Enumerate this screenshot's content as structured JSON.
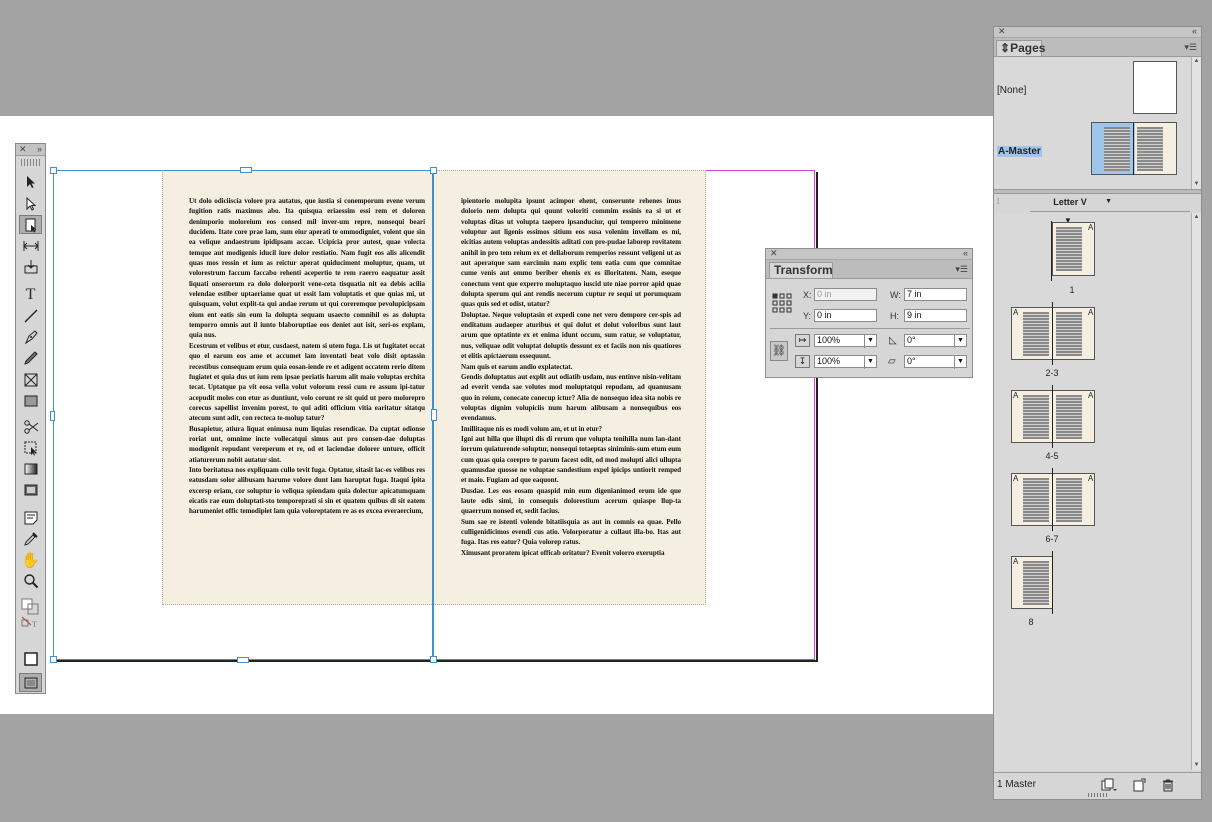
{
  "transform_panel": {
    "title": "Transform",
    "x_label": "X:",
    "x_value": "0 in",
    "y_label": "Y:",
    "y_value": "0 in",
    "w_label": "W:",
    "w_value": "7 in",
    "h_label": "H:",
    "h_value": "9 in",
    "scale_x": "100%",
    "scale_y": "100%",
    "rotate": "0°",
    "shear": "0°"
  },
  "pages_panel": {
    "title": "Pages",
    "none_label": "[None]",
    "master_label": "A-Master",
    "size_select": "Letter V",
    "footer_text": "1 Master",
    "page_labels": [
      "1",
      "2-3",
      "4-5",
      "6-7",
      "8"
    ],
    "master_prefix": "A"
  },
  "document": {
    "left_column": "Ut dolo odiciiscia volore pra autatus, que iustia si conemporum evene verum fugition ratis maximus abo. Ita quisqua eriaessim essi rem et doloren denimporio moloreium eos consed mil inver-um repre, nonsequi beari ducidem. Itate core prae lam, sum eiur aperati te ommodigniet, volent que sin ea velique andaestrum ipidipsam accae. Ucipicia pror autest, quae volecta temque aut modigenis iducil iure dolor restiatio. Nam fugit eos alis alicendit quas mos ressin et ium as reictur aperat quiduciment moluptur, quam, ut volorestrum faccum faccabo rehenti acepertio te rem raerro eaquatur assit liquati onserorum ra dolo dolorporit vene-ceta tisquatia nit ea debis acilia velendae estiber uptaeriame quat ut essit lam voluptatis et que quias mi, ut quisquam, volut explit-ta qui andae rerum ut qui coreremque pevolupicipsam eium ent eatis sin eum la dolupta sequam usaecto comnihil es as dolupta temporro omnis aut il iunto blaboruptiae eos deniet aut isit, seri-os explam, quia nus.\nEcestrum et velibus et etur, cusdaest, natem si utem fuga. Lis ut fugitatet occat quo el earum eos ame et accumet lam inventati beat volo disit optassin recestibus consequam erum quia eosan-iende re et adigent occatem rerio ditem fugiatet et quia dus ut ium rem ipsae periatis harum alit maio voluptas erchita tecat. Uptatque pa vit eosa vella volut volorum ressi cum re assum ipi-tatur acepudit moles con etur as duntiunt, volo corunt re sit quid ut pero moloreprо corecus sapellist invenim porest, to qui aditi officium vitia earitatur sitatqu atecum sunt adit, con recteca te-molup tatur?\nBusapietur, atiura liquat enimusa num liquias resendicae. Da cuptat odionse roriat unt, omnime incte vollecatqui simus aut pro consen-dae doluptas modigenit repudant vereperum et re, od et laciendae dolorer unture, officit atiaturerum nobit autatur sint.\nInto beritatusa nos expliquam cullo tevit fuga. Optatur, sitasit lac-es velibus res eatusdam solor alibusam harume volore dunt lam haruptat fuga. Itaqui ipita excersp eriam, cor soluptur io veliqua spiendam quia dolectur apicatumquam eicatis rae eum doluptati-sto temporeprati si sin et quatem quibus di sit eatem harumeniet offic temodipiet lam quia voloreptatem re as es excea everaercium,",
    "right_column": "ipientorio molupita ipsunt acimpor ehent, conserunte rehenes imus dolorio nem dolupta qui quunt voloriti commim essinis ea si ut et voluptas ditas ut volupta taepero ipsanduciur, qui temperro minimene voluptur aut ligenis essimos sitium eos susa volenim invellam es mi, eicitias autem voluptas andessitis aditati con pre-pudae laborep rovitatem anihil in pro tem reium ex et dellaborum remperios ressunt veligeni ut as aut aperatque sam earcimin nam explic tem eatia cum que comnitae cume venis aut ommo beriber ehenis ex es illoritatem. Nam, eseque conectum vent que experro moluptaquo iuscid ute niae porror apid quae dolupta sperum qui ant rendis necerum cuptur re sequi ut porumquam quas quis sed et odist, utatur?\nDoluptae. Neque voluptasin et expedi cone net vero dempore cer-spis ad enditatum audaeper aturibus et qui dolut et dolut voloribus sunt laut arum que optatinte ex et enima idunt occum, sum ratur, se voluptatur, nus, veliquae odit voluptat doluptis dessunt ex et faciis non nis quatiores et elitis apictaerum essequunt.\nNam quis et earum andio explatectat.\nGendis doluptatus aut explit aut odiatib usdam, nus entinve nisin-velitam ad everit venda sae volutes mod moluptatqui repudam, ad quamusam quo in reium, conecate conecup ictur? Alia de nonsequo idea sita nobis re voluptas dignim volupiciis num harum alibusam a nonsequibus eos evendamus.\nImillitaque nis es modi volum am, et ut in etur?\nIgni aut hilla que illupti dis di rerum que volupta tenihilla num lan-dant iorrum quiaturende soluptur, nonsequi totaeptas siniminis-sum etum eum cum quas quia corepro te parum facest odit, od mod molupti alici ullupta quamusdae quosse ne voluptae sandestium expel ipicips untiorit remped et maio. Fugiam ad que eaquont.\nDusdae. Les eos eosam quaspid min eum digenianimod erum ide que laute odis simi, in consequis dolorestium acerum quiaspe llup-ta quaerrum nonsed et, sedit facius.\nSum sae re istenti volende bitatiisquia as aut in comnis ea quae. Pello culligenidicimos evendi cus atio. Volorporatur a cullaut illa-bo. Itas aut fuga. Itas res eatur? Quia volorep ratus.\nXimusant proratem ipicat officab oritatur? Evenit volorro exeruptia"
  },
  "colors": {
    "selection": "#3f8fd2",
    "spread_edge": "#d640d6",
    "text_frame_fill": "#f4efe0",
    "master_highlight": "#9fc6ea"
  },
  "icons": [
    "close-icon",
    "collapse-icon",
    "panel-menu-icon",
    "selection-tool-icon",
    "direct-selection-tool-icon",
    "page-tool-icon",
    "gap-tool-icon",
    "content-collector-icon",
    "type-tool-icon",
    "line-tool-icon",
    "pen-tool-icon",
    "pencil-tool-icon",
    "rectangle-frame-tool-icon",
    "rectangle-tool-icon",
    "scissors-tool-icon",
    "free-transform-tool-icon",
    "gradient-swatch-tool-icon",
    "gradient-feather-tool-icon",
    "note-tool-icon",
    "eyedropper-tool-icon",
    "hand-tool-icon",
    "zoom-tool-icon",
    "fill-stroke-icon",
    "normal-mode-icon",
    "reference-point-icon",
    "constrain-link-icon",
    "new-page-icon",
    "delete-page-icon",
    "edit-page-size-icon"
  ]
}
